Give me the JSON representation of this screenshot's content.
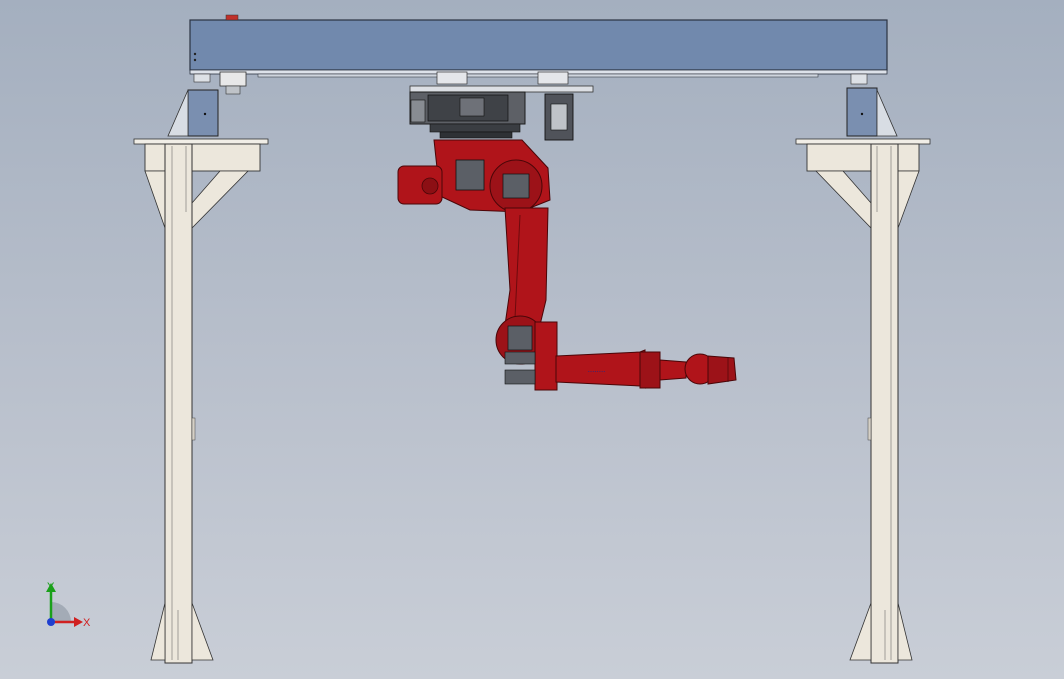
{
  "viewport": {
    "background_top": "#a4afbf",
    "background_bottom": "#c9ced7"
  },
  "colors": {
    "beam": "#7189ad",
    "frame": "#ece7dc",
    "frame_edge": "#3a3a3a",
    "robot": "#b0141a",
    "robot_dark": "#6e0a0d",
    "mechanism": "#4a4d52"
  },
  "triad": {
    "x_label": "X",
    "y_label": "Y",
    "x_color": "#d02020",
    "y_color": "#1aa01a",
    "z_color": "#1f3fd0"
  },
  "robot": {
    "arm_label": "........"
  }
}
